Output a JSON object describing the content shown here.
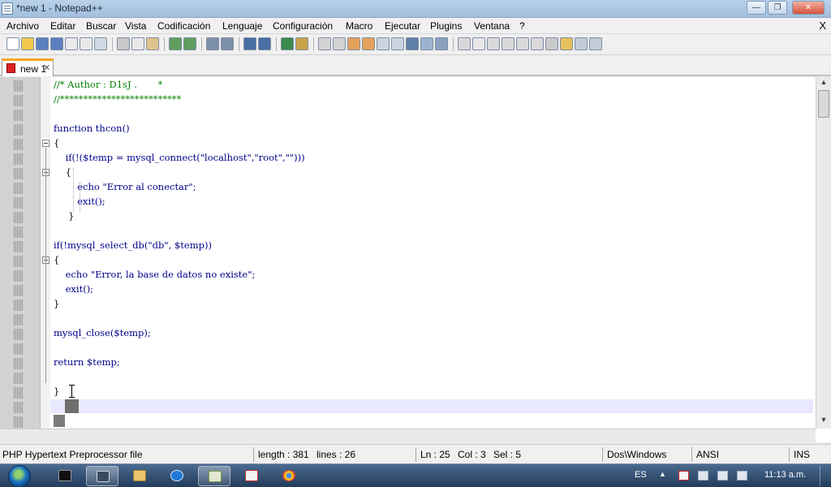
{
  "window": {
    "title": "*new 1 - Notepad++",
    "minimize": "—",
    "maximize": "❐",
    "close": "✕"
  },
  "menu": [
    "Archivo",
    "Editar",
    "Buscar",
    "Vista",
    "Codificación",
    "Lenguaje",
    "Configuración",
    "Macro",
    "Ejecutar",
    "Plugins",
    "Ventana",
    "?"
  ],
  "menu_close": "X",
  "tabs": [
    {
      "label": "new 1",
      "close": "✕"
    }
  ],
  "code_lines": [
    {
      "text": "//* Author : D1sJ .       *",
      "style": "comment"
    },
    {
      "text": "//**************************",
      "style": "comment"
    },
    {
      "text": "",
      "style": "plain"
    },
    {
      "text": "function thcon()",
      "style": "kw"
    },
    {
      "text": "{",
      "style": "plain"
    },
    {
      "text": "    if(!($temp = mysql_connect(\"localhost\",\"root\",\"\")))",
      "style": "kw"
    },
    {
      "text": "    {",
      "style": "plain"
    },
    {
      "text": "        echo \"Error al conectar\";",
      "style": "kw"
    },
    {
      "text": "        exit();",
      "style": "kw"
    },
    {
      "text": "     }",
      "style": "plain"
    },
    {
      "text": "",
      "style": "plain"
    },
    {
      "text": "if(!mysql_select_db(\"db\", $temp))",
      "style": "kw"
    },
    {
      "text": "{",
      "style": "plain"
    },
    {
      "text": "    echo \"Error, la base de datos no existe\";",
      "style": "kw"
    },
    {
      "text": "    exit();",
      "style": "kw"
    },
    {
      "text": "}",
      "style": "plain"
    },
    {
      "text": "",
      "style": "plain"
    },
    {
      "text": "mysql_close($temp);",
      "style": "kw"
    },
    {
      "text": "",
      "style": "plain"
    },
    {
      "text": "return $temp;",
      "style": "kw"
    },
    {
      "text": "",
      "style": "plain"
    },
    {
      "text": "}",
      "style": "plain"
    }
  ],
  "status": {
    "file_type": "PHP Hypertext Preprocessor file",
    "length": "length : 381",
    "lines": "lines : 26",
    "ln": "Ln : 25",
    "col": "Col : 3",
    "sel": "Sel : 5",
    "eol": "Dos\\Windows",
    "encoding": "ANSI",
    "mode": "INS"
  },
  "taskbar": {
    "language": "ES",
    "clock": "11:13 a.m."
  },
  "colors": {
    "comment": "#008000",
    "keyword": "#00008b",
    "tab_accent": "#f5a623",
    "current_line": "#e8e8ff"
  }
}
